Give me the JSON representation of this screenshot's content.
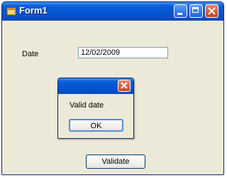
{
  "window": {
    "title": "Form1",
    "icon": "app-form-icon",
    "controls": [
      "minimize-icon",
      "maximize-icon",
      "close-icon"
    ]
  },
  "form": {
    "date_label": "Date",
    "date_value": "12/02/2009",
    "validate_label": "Validate"
  },
  "dialog": {
    "message": "Valid date",
    "ok_label": "OK",
    "close_icon": "close-icon"
  },
  "colors": {
    "titlebar": "#0553d1",
    "close_button": "#c8421b",
    "client_background": "#ece9d8"
  }
}
